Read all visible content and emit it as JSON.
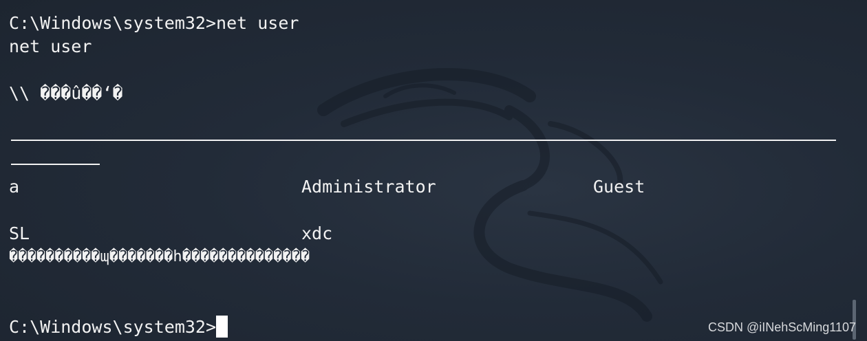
{
  "terminal": {
    "prompt_1": "C:\\Windows\\system32>net user",
    "echo": "net user",
    "header_garbled": "\\\\ ���û��‘�",
    "users": {
      "row1": [
        "a",
        "Administrator",
        "Guest"
      ],
      "row2": [
        "SL",
        "xdc"
      ]
    },
    "status_garbled": "����������ɰ�������h��������������",
    "prompt_2": "C:\\Windows\\system32>"
  },
  "watermark": "CSDN @iINehScMing1107",
  "colors": {
    "background": "#222b38",
    "text": "#f2f2f2"
  }
}
